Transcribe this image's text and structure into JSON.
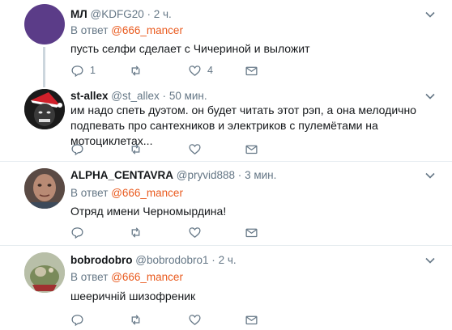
{
  "reply_prefix": "В ответ",
  "tweets": [
    {
      "name": "МЛ",
      "handle": "@KDFG20",
      "separator": "·",
      "time": "2 ч.",
      "reply_to": "@666_mancer",
      "text": "пусть селфи сделает с Чичериной и выложит",
      "reply_count": "1",
      "retweet_count": "",
      "like_count": "4"
    },
    {
      "name": "st-allex",
      "handle": "@st_allex",
      "separator": "·",
      "time": "50 мин.",
      "text": "им надо спеть дуэтом. он будет читать этот рэп, а она мелодично подпевать про сантехников и электриков с пулемётами на мотоциклетах...",
      "reply_count": "",
      "retweet_count": "",
      "like_count": ""
    },
    {
      "name": "ALPHA_CENTAVRA",
      "handle": "@pryvid888",
      "separator": "·",
      "time": "3 мин.",
      "reply_to": "@666_mancer",
      "text": "Отряд имени Черномырдина!",
      "reply_count": "",
      "retweet_count": "",
      "like_count": ""
    },
    {
      "name": "bobrodobro",
      "handle": "@bobrodobro1",
      "separator": "·",
      "time": "2 ч.",
      "reply_to": "@666_mancer",
      "text": "шееричній шизофреник",
      "reply_count": "",
      "retweet_count": "",
      "like_count": ""
    }
  ],
  "colors": {
    "accent_mention": "#e95a1e",
    "meta_gray": "#657786",
    "divider": "#e6ecf0",
    "avatar_purple": "#5b3c88"
  }
}
